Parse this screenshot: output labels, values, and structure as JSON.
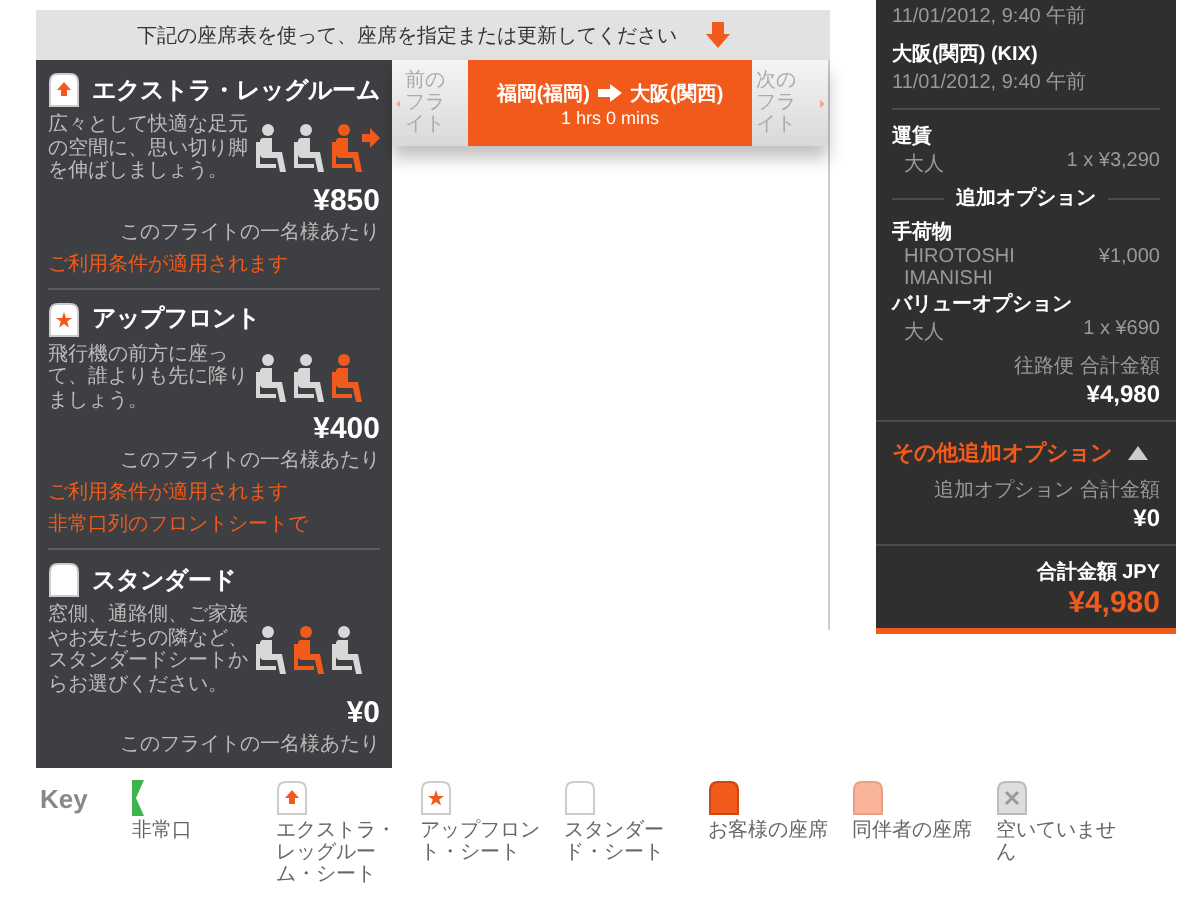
{
  "header": {
    "instruction": "下記の座席表を使って、座席を指定または更新してください"
  },
  "seat_types": [
    {
      "kind": "extra",
      "title": "エクストラ・レッグルーム",
      "description": "広々として快適な足元の空間に、思い切り脚を伸ばしましょう。",
      "seats": [
        {
          "highlighted": false
        },
        {
          "highlighted": false
        },
        {
          "highlighted": true
        }
      ],
      "price": "¥850",
      "per": "このフライトの一名様あたり",
      "notes": [
        "ご利用条件が適用されます"
      ]
    },
    {
      "kind": "upfront",
      "title": "アップフロント",
      "description": "飛行機の前方に座って、誰よりも先に降りましょう。",
      "seats": [
        {
          "highlighted": false
        },
        {
          "highlighted": false
        },
        {
          "highlighted": true
        }
      ],
      "price": "¥400",
      "per": "このフライトの一名様あたり",
      "notes": [
        "ご利用条件が適用されます",
        "非常口列のフロントシートで"
      ]
    },
    {
      "kind": "standard",
      "title": "スタンダード",
      "description": "窓側、通路側、ご家族やお友だちの隣など、スタンダードシートからお選びください。",
      "seats": [
        {
          "highlighted": false
        },
        {
          "highlighted": true
        },
        {
          "highlighted": false
        }
      ],
      "price": "¥0",
      "per": "このフライトの一名様あたり"
    }
  ],
  "flight_nav": {
    "previous": "前のフライト",
    "next": "次のフライト",
    "origin": "福岡(福岡)",
    "destination": "大阪(関西)",
    "duration": "1 hrs 0 mins"
  },
  "summary": {
    "cut_line": "11/01/2012, 9:40 午前",
    "arrival": "大阪(関西) (KIX)",
    "arrival_time": "11/01/2012, 9:40 午前",
    "fare_label": "運賃",
    "fare_row": {
      "label": "大人",
      "value": "1 x ¥3,290"
    },
    "options_heading": "追加オプション",
    "options": [
      {
        "name": "手荷物",
        "detail": "HIROTOSHI IMANISHI",
        "value": "¥1,000"
      },
      {
        "name": "バリューオプション",
        "detail": "大人",
        "value": "1 x ¥690"
      }
    ],
    "outbound_label": "往路便 合計金額",
    "outbound_total": "¥4,980",
    "other_title": "その他追加オプション",
    "other_expanded": true,
    "other_label": "追加オプション 合計金額",
    "other_total": "¥0",
    "grand_label": "合計金額 JPY",
    "grand_total": "¥4,980"
  },
  "key": {
    "title": "Key",
    "items": [
      {
        "kind": "exit",
        "label": "非常口"
      },
      {
        "kind": "extra",
        "label": "エクストラ・レッグルーム・シート"
      },
      {
        "kind": "upfront",
        "label": "アップフロント・シート"
      },
      {
        "kind": "standard",
        "label": "スタンダード・シート"
      },
      {
        "kind": "mine",
        "label": "お客様の座席"
      },
      {
        "kind": "companion",
        "label": "同伴者の座席"
      },
      {
        "kind": "unavailable",
        "label": "空いていません"
      }
    ]
  }
}
